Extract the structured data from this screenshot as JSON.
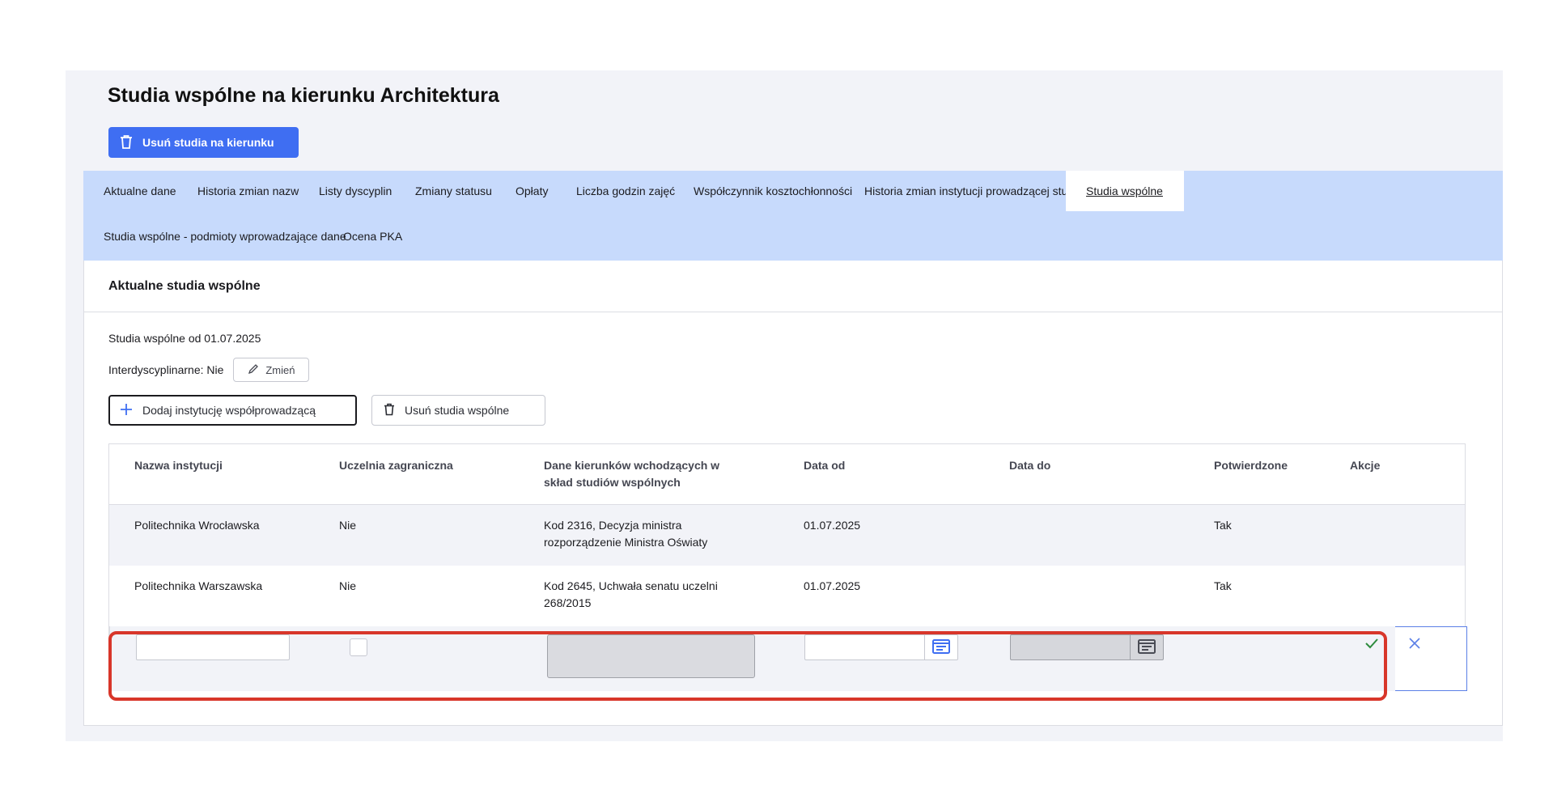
{
  "page": {
    "title": "Studia wspólne na kierunku Architektura",
    "delete_major_label": "Usuń studia na kierunku"
  },
  "tabs": [
    {
      "label": "Aktualne dane"
    },
    {
      "label": "Historia zmian nazw"
    },
    {
      "label": "Listy dyscyplin"
    },
    {
      "label": "Zmiany statusu"
    },
    {
      "label": "Opłaty"
    },
    {
      "label": "Liczba godzin zajęć"
    },
    {
      "label": "Współczynnik kosztochłonności"
    },
    {
      "label": "Historia zmian instytucji prowadzącej studia"
    },
    {
      "label": "Studia wspólne",
      "active": true
    },
    {
      "label": "Studia wspólne - podmioty wprowadzające dane"
    },
    {
      "label": "Ocena PKA"
    }
  ],
  "card": {
    "title": "Aktualne studia wspólne",
    "since_text": "Studia wspólne od 01.07.2025",
    "interdisciplinary_text": "Interdyscyplinarne: Nie",
    "change_label": "Zmień",
    "add_institution_label": "Dodaj instytucję współprowadzącą",
    "remove_joint_label": "Usuń studia wspólne"
  },
  "table": {
    "headers": {
      "name": "Nazwa instytucji",
      "foreign": "Uczelnia zagraniczna",
      "majors_line1": "Dane kierunków wchodzących w",
      "majors_line2": "skład studiów wspólnych",
      "date_from": "Data od",
      "date_to": "Data do",
      "confirmed": "Potwierdzone",
      "actions": "Akcje"
    },
    "rows": [
      {
        "name": "Politechnika Wrocławska",
        "foreign": "Nie",
        "majors_line1": "Kod 2316, Decyzja ministra",
        "majors_line2": "rozporządzenie Ministra Oświaty",
        "date_from": "01.07.2025",
        "date_to": "",
        "confirmed": "Tak"
      },
      {
        "name": "Politechnika Warszawska",
        "foreign": "Nie",
        "majors_line1": "Kod 2645, Uchwała senatu uczelni",
        "majors_line2": "268/2015",
        "date_from": "01.07.2025",
        "date_to": "",
        "confirmed": "Tak"
      }
    ],
    "edit_row": {
      "name_value": "",
      "date_from_value": "",
      "date_to_value": ""
    }
  },
  "icons": {
    "trash": "trash-icon",
    "pencil": "pencil-icon",
    "plus": "plus-icon",
    "calendar": "calendar-icon",
    "check": "check-icon",
    "close": "close-icon"
  },
  "colors": {
    "primary": "#3f6ef2",
    "tab_bar": "#c7dafc",
    "highlight": "#d8362a",
    "confirm": "#2e8b3e"
  }
}
